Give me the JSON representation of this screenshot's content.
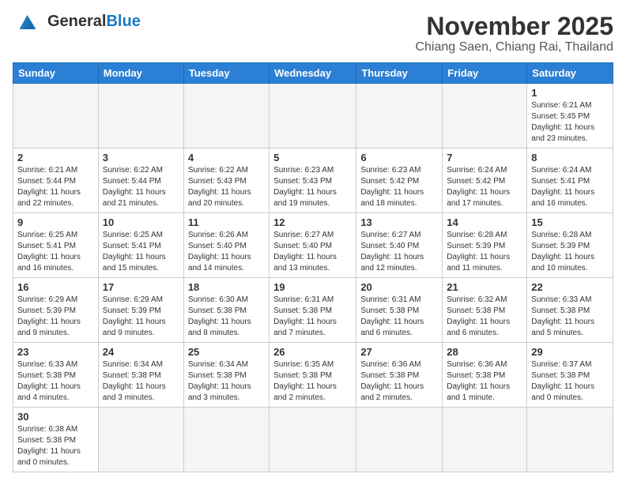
{
  "logo": {
    "line1": "General",
    "line2": "Blue"
  },
  "header": {
    "month_year": "November 2025",
    "location": "Chiang Saen, Chiang Rai, Thailand"
  },
  "weekdays": [
    "Sunday",
    "Monday",
    "Tuesday",
    "Wednesday",
    "Thursday",
    "Friday",
    "Saturday"
  ],
  "weeks": [
    [
      {
        "day": "",
        "info": ""
      },
      {
        "day": "",
        "info": ""
      },
      {
        "day": "",
        "info": ""
      },
      {
        "day": "",
        "info": ""
      },
      {
        "day": "",
        "info": ""
      },
      {
        "day": "",
        "info": ""
      },
      {
        "day": "1",
        "info": "Sunrise: 6:21 AM\nSunset: 5:45 PM\nDaylight: 11 hours\nand 23 minutes."
      }
    ],
    [
      {
        "day": "2",
        "info": "Sunrise: 6:21 AM\nSunset: 5:44 PM\nDaylight: 11 hours\nand 22 minutes."
      },
      {
        "day": "3",
        "info": "Sunrise: 6:22 AM\nSunset: 5:44 PM\nDaylight: 11 hours\nand 21 minutes."
      },
      {
        "day": "4",
        "info": "Sunrise: 6:22 AM\nSunset: 5:43 PM\nDaylight: 11 hours\nand 20 minutes."
      },
      {
        "day": "5",
        "info": "Sunrise: 6:23 AM\nSunset: 5:43 PM\nDaylight: 11 hours\nand 19 minutes."
      },
      {
        "day": "6",
        "info": "Sunrise: 6:23 AM\nSunset: 5:42 PM\nDaylight: 11 hours\nand 18 minutes."
      },
      {
        "day": "7",
        "info": "Sunrise: 6:24 AM\nSunset: 5:42 PM\nDaylight: 11 hours\nand 17 minutes."
      },
      {
        "day": "8",
        "info": "Sunrise: 6:24 AM\nSunset: 5:41 PM\nDaylight: 11 hours\nand 16 minutes."
      }
    ],
    [
      {
        "day": "9",
        "info": "Sunrise: 6:25 AM\nSunset: 5:41 PM\nDaylight: 11 hours\nand 16 minutes."
      },
      {
        "day": "10",
        "info": "Sunrise: 6:25 AM\nSunset: 5:41 PM\nDaylight: 11 hours\nand 15 minutes."
      },
      {
        "day": "11",
        "info": "Sunrise: 6:26 AM\nSunset: 5:40 PM\nDaylight: 11 hours\nand 14 minutes."
      },
      {
        "day": "12",
        "info": "Sunrise: 6:27 AM\nSunset: 5:40 PM\nDaylight: 11 hours\nand 13 minutes."
      },
      {
        "day": "13",
        "info": "Sunrise: 6:27 AM\nSunset: 5:40 PM\nDaylight: 11 hours\nand 12 minutes."
      },
      {
        "day": "14",
        "info": "Sunrise: 6:28 AM\nSunset: 5:39 PM\nDaylight: 11 hours\nand 11 minutes."
      },
      {
        "day": "15",
        "info": "Sunrise: 6:28 AM\nSunset: 5:39 PM\nDaylight: 11 hours\nand 10 minutes."
      }
    ],
    [
      {
        "day": "16",
        "info": "Sunrise: 6:29 AM\nSunset: 5:39 PM\nDaylight: 11 hours\nand 9 minutes."
      },
      {
        "day": "17",
        "info": "Sunrise: 6:29 AM\nSunset: 5:39 PM\nDaylight: 11 hours\nand 9 minutes."
      },
      {
        "day": "18",
        "info": "Sunrise: 6:30 AM\nSunset: 5:38 PM\nDaylight: 11 hours\nand 8 minutes."
      },
      {
        "day": "19",
        "info": "Sunrise: 6:31 AM\nSunset: 5:38 PM\nDaylight: 11 hours\nand 7 minutes."
      },
      {
        "day": "20",
        "info": "Sunrise: 6:31 AM\nSunset: 5:38 PM\nDaylight: 11 hours\nand 6 minutes."
      },
      {
        "day": "21",
        "info": "Sunrise: 6:32 AM\nSunset: 5:38 PM\nDaylight: 11 hours\nand 6 minutes."
      },
      {
        "day": "22",
        "info": "Sunrise: 6:33 AM\nSunset: 5:38 PM\nDaylight: 11 hours\nand 5 minutes."
      }
    ],
    [
      {
        "day": "23",
        "info": "Sunrise: 6:33 AM\nSunset: 5:38 PM\nDaylight: 11 hours\nand 4 minutes."
      },
      {
        "day": "24",
        "info": "Sunrise: 6:34 AM\nSunset: 5:38 PM\nDaylight: 11 hours\nand 3 minutes."
      },
      {
        "day": "25",
        "info": "Sunrise: 6:34 AM\nSunset: 5:38 PM\nDaylight: 11 hours\nand 3 minutes."
      },
      {
        "day": "26",
        "info": "Sunrise: 6:35 AM\nSunset: 5:38 PM\nDaylight: 11 hours\nand 2 minutes."
      },
      {
        "day": "27",
        "info": "Sunrise: 6:36 AM\nSunset: 5:38 PM\nDaylight: 11 hours\nand 2 minutes."
      },
      {
        "day": "28",
        "info": "Sunrise: 6:36 AM\nSunset: 5:38 PM\nDaylight: 11 hours\nand 1 minute."
      },
      {
        "day": "29",
        "info": "Sunrise: 6:37 AM\nSunset: 5:38 PM\nDaylight: 11 hours\nand 0 minutes."
      }
    ],
    [
      {
        "day": "30",
        "info": "Sunrise: 6:38 AM\nSunset: 5:38 PM\nDaylight: 11 hours\nand 0 minutes."
      },
      {
        "day": "",
        "info": ""
      },
      {
        "day": "",
        "info": ""
      },
      {
        "day": "",
        "info": ""
      },
      {
        "day": "",
        "info": ""
      },
      {
        "day": "",
        "info": ""
      },
      {
        "day": "",
        "info": ""
      }
    ]
  ]
}
